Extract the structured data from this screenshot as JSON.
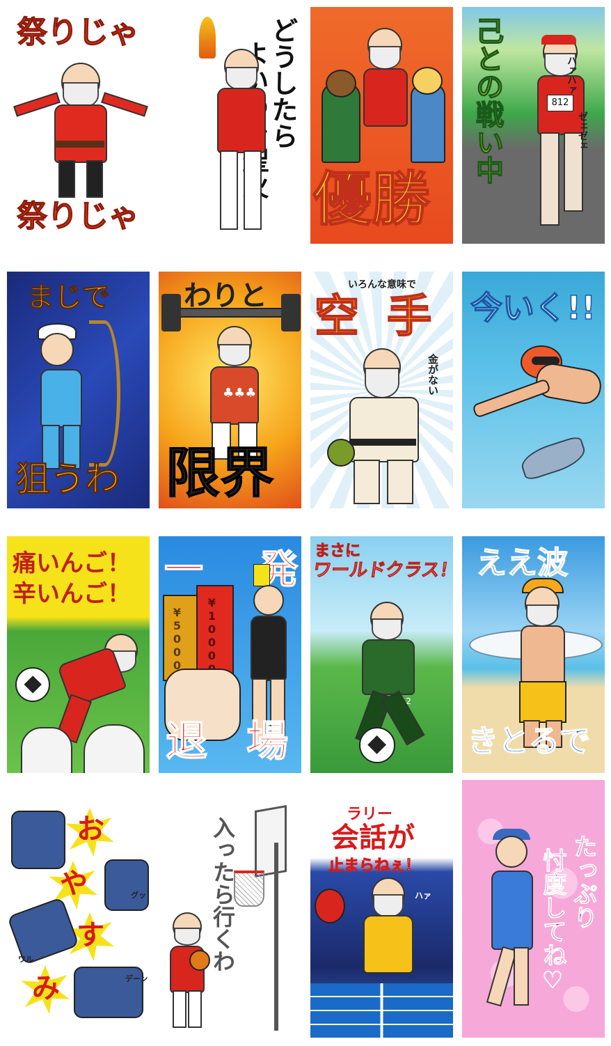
{
  "stickers": [
    {
      "id": "matsuri",
      "top": "祭りじゃ",
      "bottom": "祭りじゃ"
    },
    {
      "id": "seika",
      "vertical_right": "どうしたら",
      "vertical_mid": "よいので聖火"
    },
    {
      "id": "yusho",
      "text": "優勝"
    },
    {
      "id": "tatakai",
      "vertical": "己との戦い中",
      "sfx1": "ハァハァ",
      "sfx2": "ゼェゼェ",
      "bib": "812"
    },
    {
      "id": "archery",
      "top": "まじで",
      "bottom": "狙うわ"
    },
    {
      "id": "weight",
      "top": "わりと",
      "bottom": "限界"
    },
    {
      "id": "karate",
      "small": "いろんな意味で",
      "big": "空手",
      "side": "金がない"
    },
    {
      "id": "swim",
      "text": "今いく!!"
    },
    {
      "id": "itai",
      "line1": "痛いんご！",
      "line2": "辛いんご！"
    },
    {
      "id": "redcard",
      "top": "一発",
      "bottom_left": "退",
      "bottom_right": "場",
      "note1": "¥5000",
      "note2": "¥10000"
    },
    {
      "id": "soccer",
      "small": "まさに",
      "big": "ワールドクラス！",
      "shorts": "312"
    },
    {
      "id": "surf",
      "top": "ええ波",
      "bottom": "きとるで"
    },
    {
      "id": "judo",
      "chars": [
        "お",
        "や",
        "す",
        "み"
      ],
      "sfx1": "グッ",
      "sfx2": "ワル",
      "sfx3": "デーン"
    },
    {
      "id": "basket",
      "vertical": "入ったら行くわ"
    },
    {
      "id": "pingpong",
      "small": "ラリー",
      "big": "会話が",
      "line3": "止まらねぇ！",
      "sfx": "ハァ"
    },
    {
      "id": "golf",
      "vertical_left": "たっぷり",
      "vertical_right": "忖度してね♡"
    }
  ],
  "colors": {
    "red": "#d62a1e",
    "orange": "#f08a1a",
    "gold": "#f6c21a",
    "blue_text": "#1a6ec8",
    "pink": "#f48cc8",
    "magenta": "#e01a8a",
    "green": "#2f9a3a",
    "sea": "#3aa8d8"
  }
}
